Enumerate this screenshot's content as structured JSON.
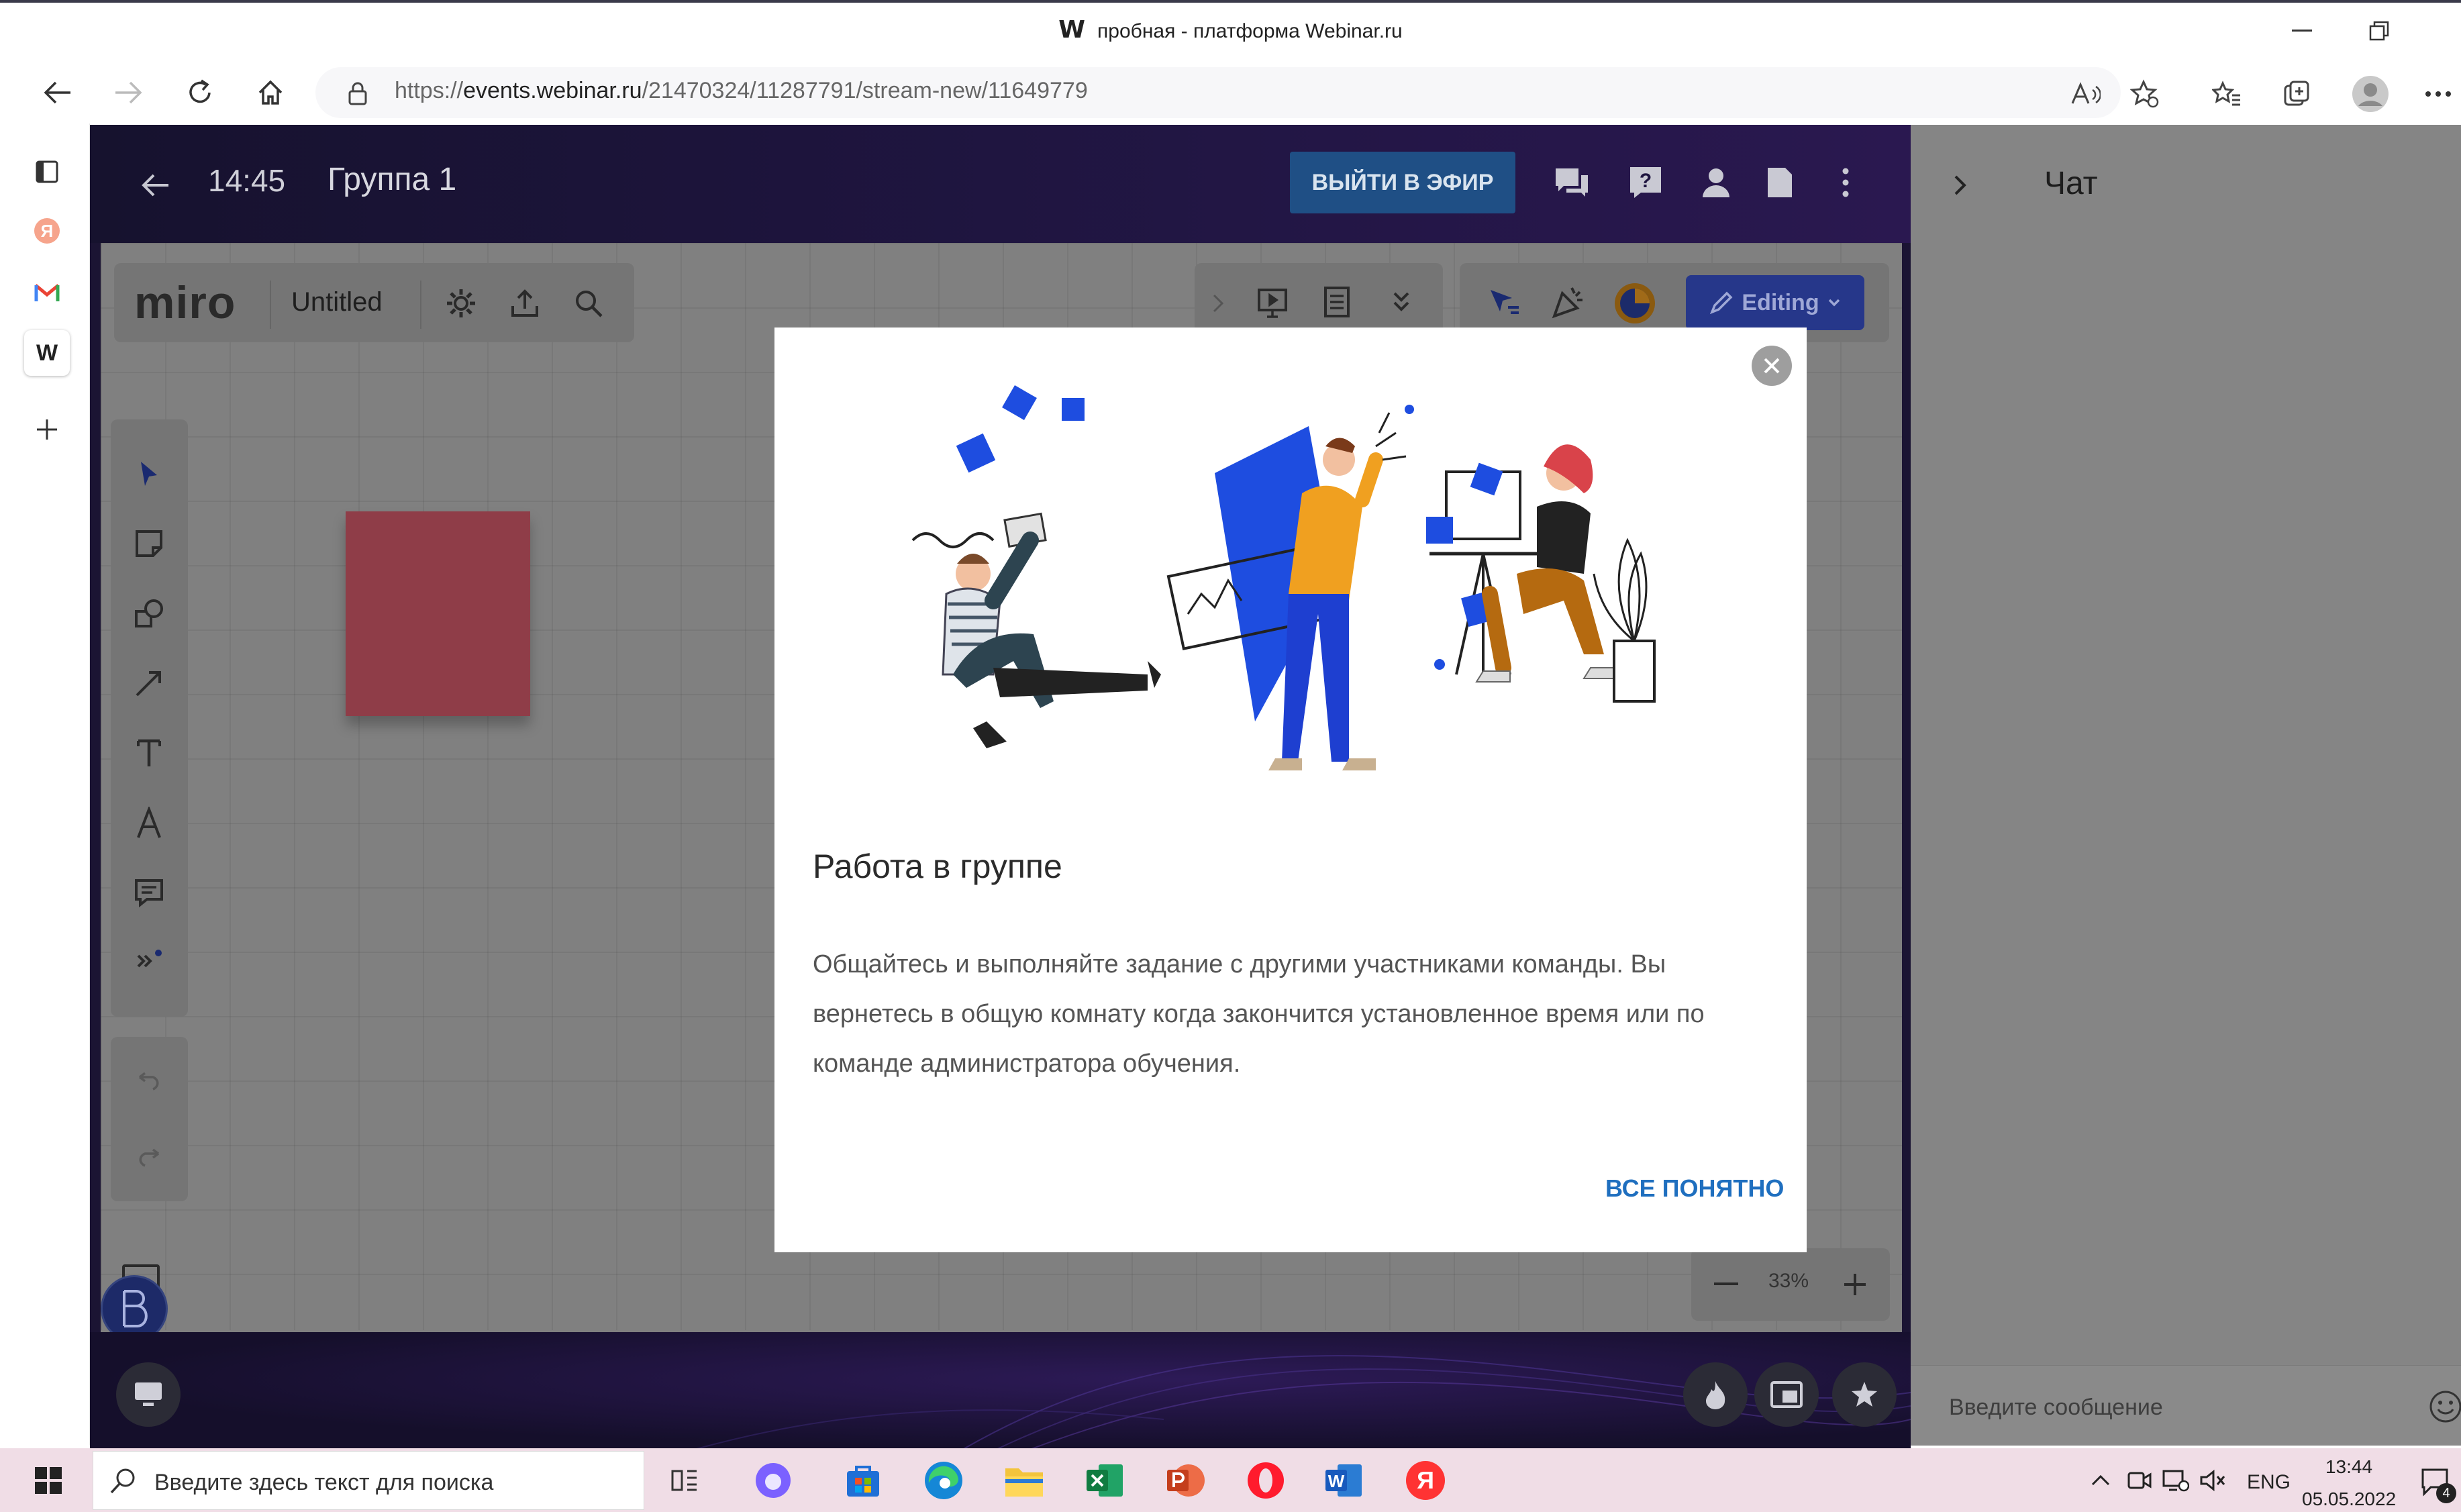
{
  "browser": {
    "tab_logo": "W",
    "window_title": "пробная - платформа Webinar.ru",
    "url_prefix": "https://",
    "url_host": "events.webinar.ru",
    "url_path": "/21470324/11287791/stream-new/11649779"
  },
  "sidebar": {
    "active_tab_letter": "W",
    "yandex_letter": "Я"
  },
  "webinar": {
    "time": "14:45",
    "group_name": "Группа 1",
    "go_live_label": "ВЫЙТИ В ЭФИР"
  },
  "miro": {
    "logo": "miro",
    "board_title": "Untitled",
    "editing_label": "Editing",
    "zoom_value": "33%"
  },
  "chat": {
    "title": "Чат",
    "input_placeholder": "Введите сообщение"
  },
  "modal": {
    "title": "Работа в группе",
    "body": "Общайтесь и выполняйте задание с другими участниками команды. Вы вернетесь в общую комнату когда закончится установленное время или по команде администратора обучения.",
    "confirm_label": "ВСЕ ПОНЯТНО"
  },
  "taskbar": {
    "search_placeholder": "Введите здесь текст для поиска",
    "language": "ENG",
    "time": "13:44",
    "date": "05.05.2022",
    "notification_count": "4",
    "word_letter": "W",
    "yandex_letter": "Я"
  },
  "colors": {
    "webinar_bar": "#1f1540",
    "go_live": "#1f4f85",
    "miro_editing": "#26378a",
    "modal_accent": "#1f6fbf",
    "illustration_blue": "#1e4de0",
    "illustration_orange": "#f0a020"
  }
}
